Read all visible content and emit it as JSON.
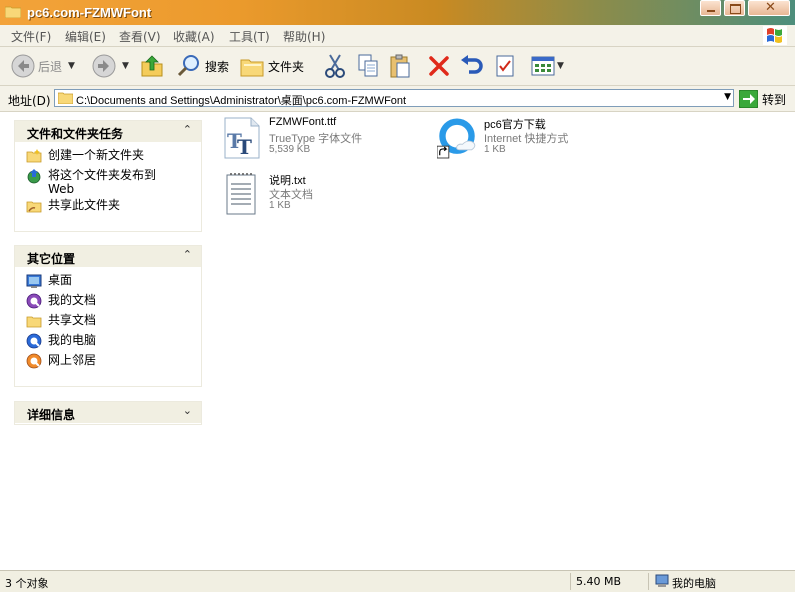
{
  "window": {
    "title": "pc6.com-FZMWFont"
  },
  "menu": [
    "文件(F)",
    "编辑(E)",
    "查看(V)",
    "收藏(A)",
    "工具(T)",
    "帮助(H)"
  ],
  "toolbar": {
    "back": "后退",
    "search": "搜索",
    "folders": "文件夹"
  },
  "address": {
    "label": "地址(D)",
    "value": "C:\\Documents and Settings\\Administrator\\桌面\\pc6.com-FZMWFont",
    "go": "转到"
  },
  "tasks": {
    "title": "文件和文件夹任务",
    "items": [
      {
        "label": "创建一个新文件夹",
        "icon": "new-folder-icon"
      },
      {
        "label": "将这个文件夹发布到 Web",
        "icon": "publish-web-icon"
      },
      {
        "label": "共享此文件夹",
        "icon": "share-folder-icon"
      }
    ]
  },
  "places": {
    "title": "其它位置",
    "items": [
      {
        "label": "桌面",
        "icon": "desktop-icon"
      },
      {
        "label": "我的文档",
        "icon": "my-documents-icon"
      },
      {
        "label": "共享文档",
        "icon": "shared-documents-icon"
      },
      {
        "label": "我的电脑",
        "icon": "my-computer-icon"
      },
      {
        "label": "网上邻居",
        "icon": "network-icon"
      }
    ]
  },
  "details": {
    "title": "详细信息"
  },
  "files": [
    {
      "name": "FZMWFont.ttf",
      "type": "TrueType 字体文件",
      "size": "5,539 KB",
      "icon": "truetype-font-icon"
    },
    {
      "name": "pc6官方下载",
      "type": "Internet 快捷方式",
      "size": "1 KB",
      "icon": "internet-shortcut-icon"
    },
    {
      "name": "说明.txt",
      "type": "文本文档",
      "size": "1 KB",
      "icon": "text-document-icon"
    }
  ],
  "status": {
    "count": "3 个对象",
    "size": "5.40 MB",
    "location": "我的电脑"
  },
  "colors": {
    "titlebar_start": "#f3a33a",
    "titlebar_end": "#4d8e7c",
    "panel_header": "#f1efe2",
    "chrome": "#f4f2e8"
  }
}
